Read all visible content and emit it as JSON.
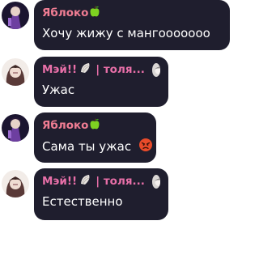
{
  "messages": [
    {
      "sender": "Яблоко",
      "sender_emoji": "green-apple-icon",
      "text": "Хочу жижу с мангооооооо"
    },
    {
      "sender": "Мэй!!",
      "sender_emoji": "shell-icon",
      "separator": "| толя...",
      "text": "Ужас"
    },
    {
      "sender": "Яблоко",
      "sender_emoji": "green-apple-icon",
      "text": "Сама ты ужас",
      "text_emoji": "angry-face-icon"
    },
    {
      "sender": "Мэй!!",
      "sender_emoji": "shell-icon",
      "separator": "| толя...",
      "text": "Естественно"
    }
  ],
  "colors": {
    "bubble": "#1f1e2e",
    "name_yabloko": "#f07d93",
    "name_mei": "#e86fa8",
    "text": "#ffffff"
  }
}
